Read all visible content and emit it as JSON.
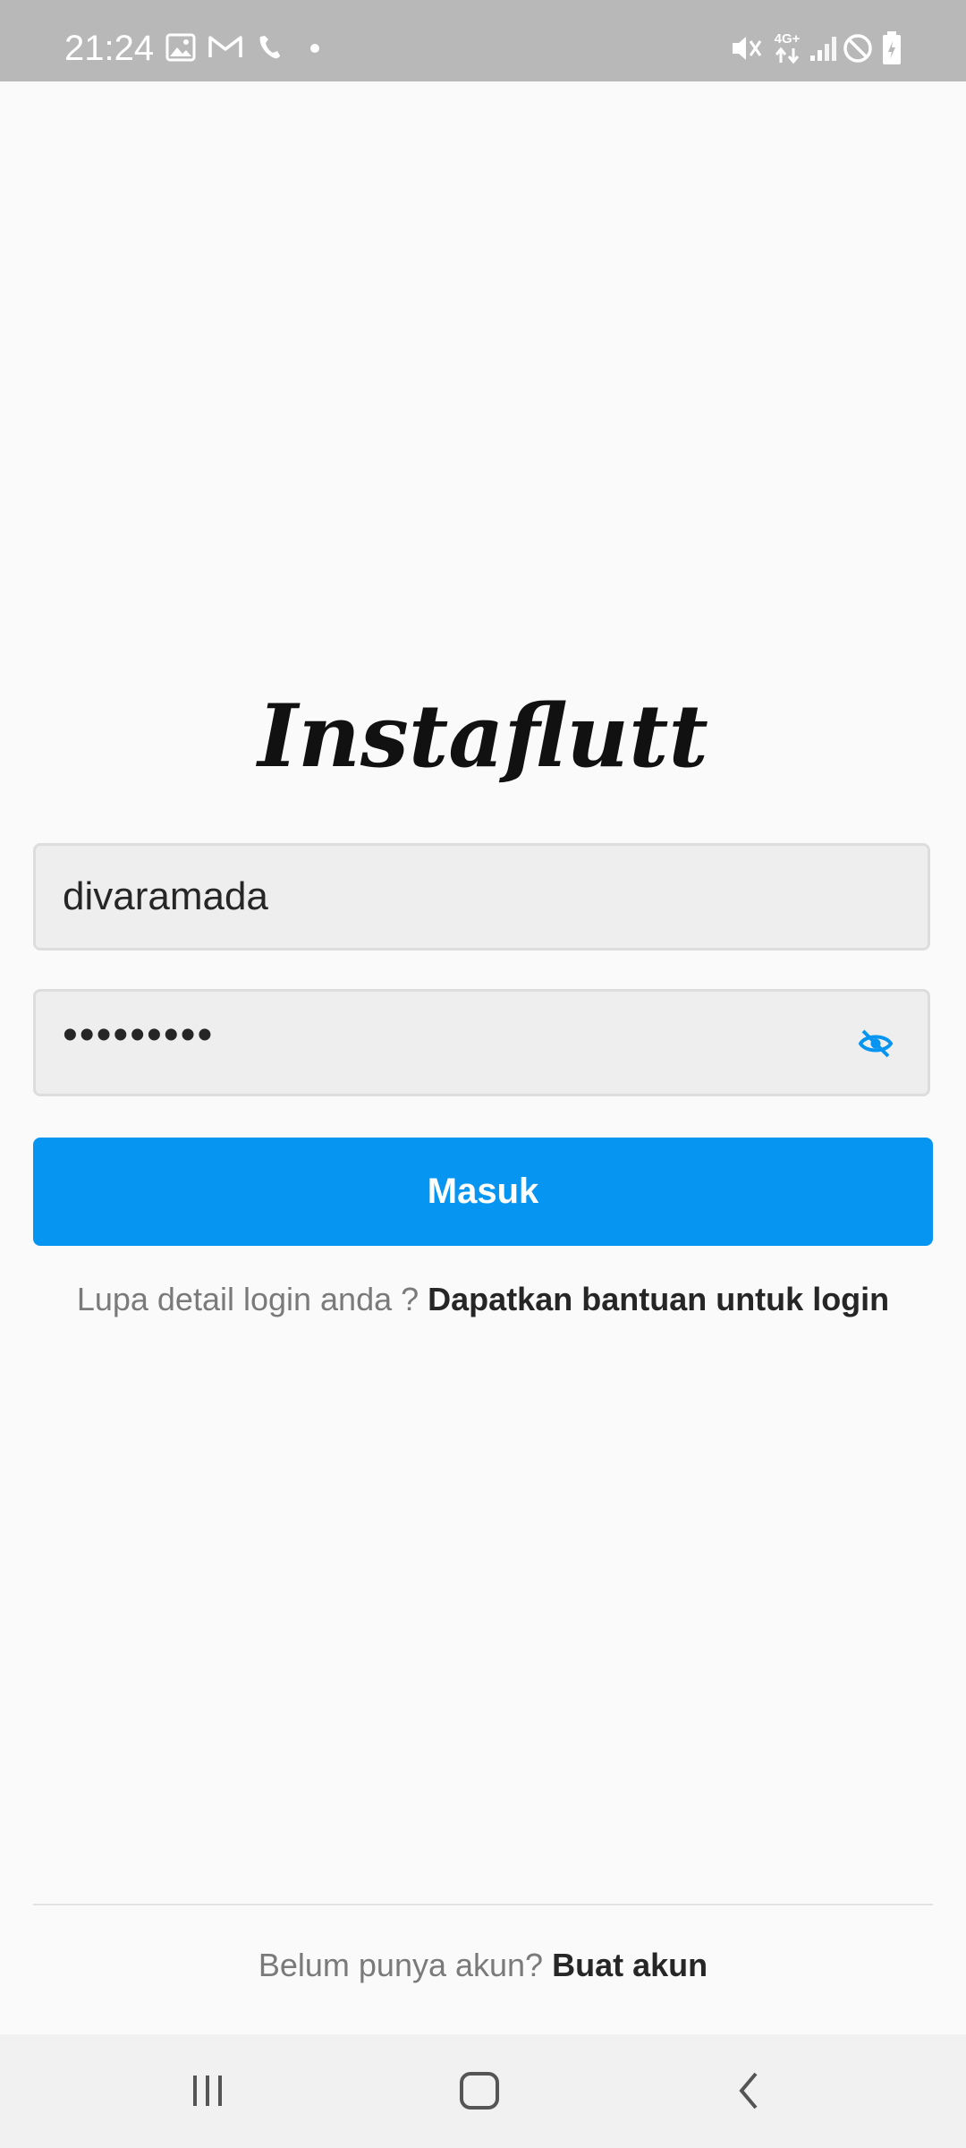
{
  "status_bar": {
    "time": "21:24",
    "icons": [
      "image-icon",
      "gmail-icon",
      "phone-missed-icon",
      "dot-icon",
      "mute-icon",
      "4g-lte-icon",
      "signal-icon",
      "do-not-disturb-icon",
      "battery-icon"
    ],
    "network_label": "4G+"
  },
  "app": {
    "logo": "Instaflutt"
  },
  "login": {
    "username_value": "divaramada",
    "password_value": "•••••••••",
    "password_toggle_icon": "eye-off-icon",
    "submit_label": "Masuk",
    "help_prefix": "Lupa detail login anda ?",
    "help_link": "Dapatkan bantuan untuk login"
  },
  "signup": {
    "prefix": "Belum punya akun?",
    "link": "Buat akun"
  },
  "colors": {
    "primary": "#0795f2",
    "background": "#fafafa",
    "field_bg": "#eeeeee",
    "status_bar": "#b8b8b8"
  },
  "nav_bar": {
    "items": [
      "recent-apps-icon",
      "home-icon",
      "back-icon"
    ]
  }
}
